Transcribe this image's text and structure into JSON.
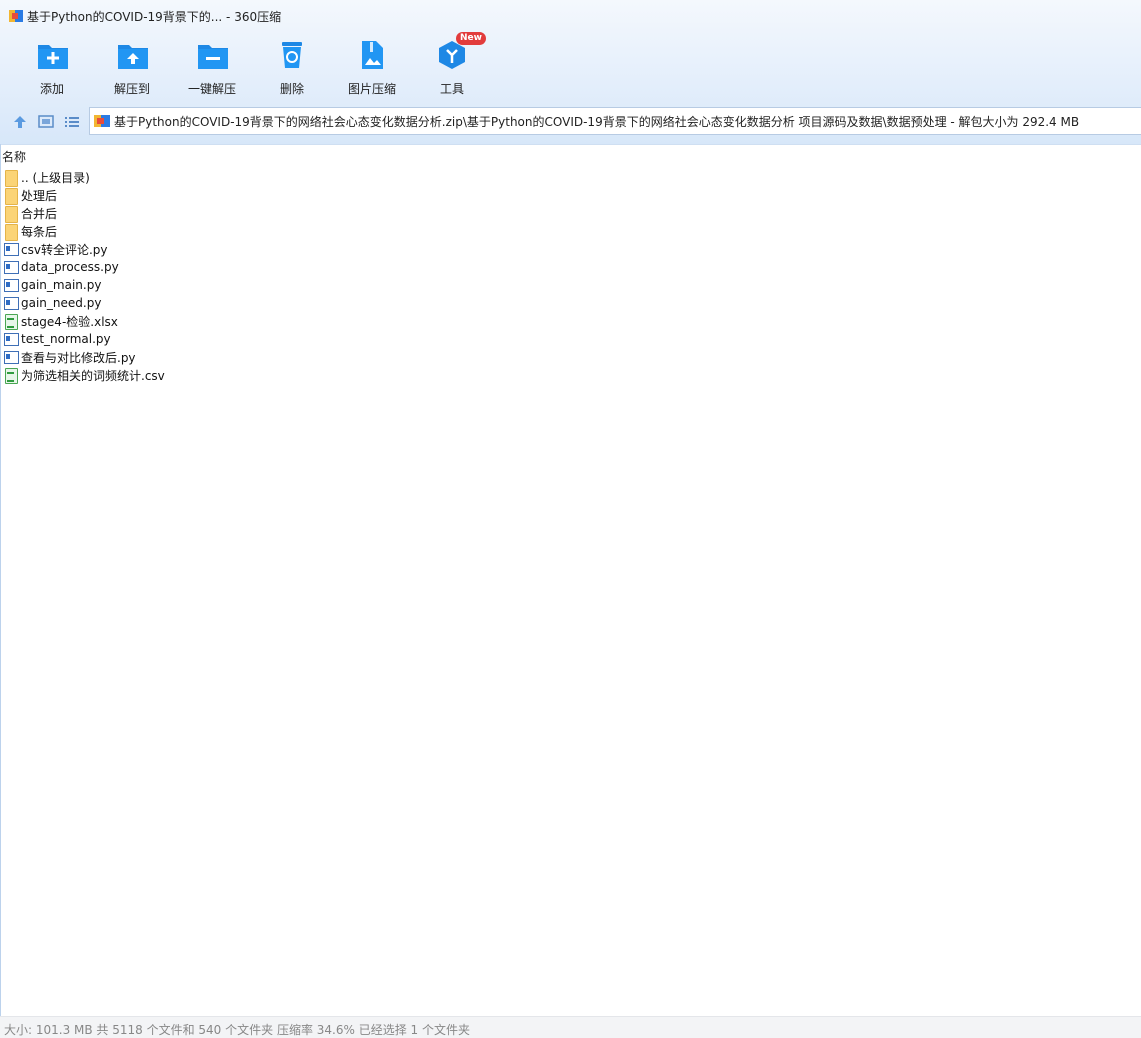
{
  "window": {
    "title": "基于Python的COVID-19背景下的... - 360压缩"
  },
  "toolbar": {
    "items": [
      {
        "label": "添加",
        "icon": "add-icon"
      },
      {
        "label": "解压到",
        "icon": "extract-to-icon"
      },
      {
        "label": "一键解压",
        "icon": "one-click-extract-icon"
      },
      {
        "label": "删除",
        "icon": "delete-icon"
      },
      {
        "label": "图片压缩",
        "icon": "image-compress-icon"
      },
      {
        "label": "工具",
        "icon": "tools-icon",
        "badge": "New"
      }
    ]
  },
  "nav": {
    "path": "基于Python的COVID-19背景下的网络社会心态变化数据分析.zip\\基于Python的COVID-19背景下的网络社会心态变化数据分析 项目源码及数据\\数据预处理 - 解包大小为 292.4 MB"
  },
  "list": {
    "column_name": "名称",
    "files": [
      {
        "name": ".. (上级目录)",
        "type": "folder"
      },
      {
        "name": "处理后",
        "type": "folder"
      },
      {
        "name": "合并后",
        "type": "folder"
      },
      {
        "name": "每条后",
        "type": "folder"
      },
      {
        "name": "csv转全评论.py",
        "type": "py"
      },
      {
        "name": "data_process.py",
        "type": "py"
      },
      {
        "name": "gain_main.py",
        "type": "py"
      },
      {
        "name": "gain_need.py",
        "type": "py"
      },
      {
        "name": "stage4-检验.xlsx",
        "type": "xlsx"
      },
      {
        "name": "test_normal.py",
        "type": "py"
      },
      {
        "name": "查看与对比修改后.py",
        "type": "py"
      },
      {
        "name": "为筛选相关的词频统计.csv",
        "type": "csv"
      }
    ]
  },
  "status": {
    "text": "大小: 101.3 MB 共 5118 个文件和 540 个文件夹 压缩率 34.6% 已经选择 1 个文件夹"
  },
  "colors": {
    "accent_blue": "#1e88e5",
    "badge_red": "#e23c3c",
    "folder_yellow": "#fbd476"
  }
}
